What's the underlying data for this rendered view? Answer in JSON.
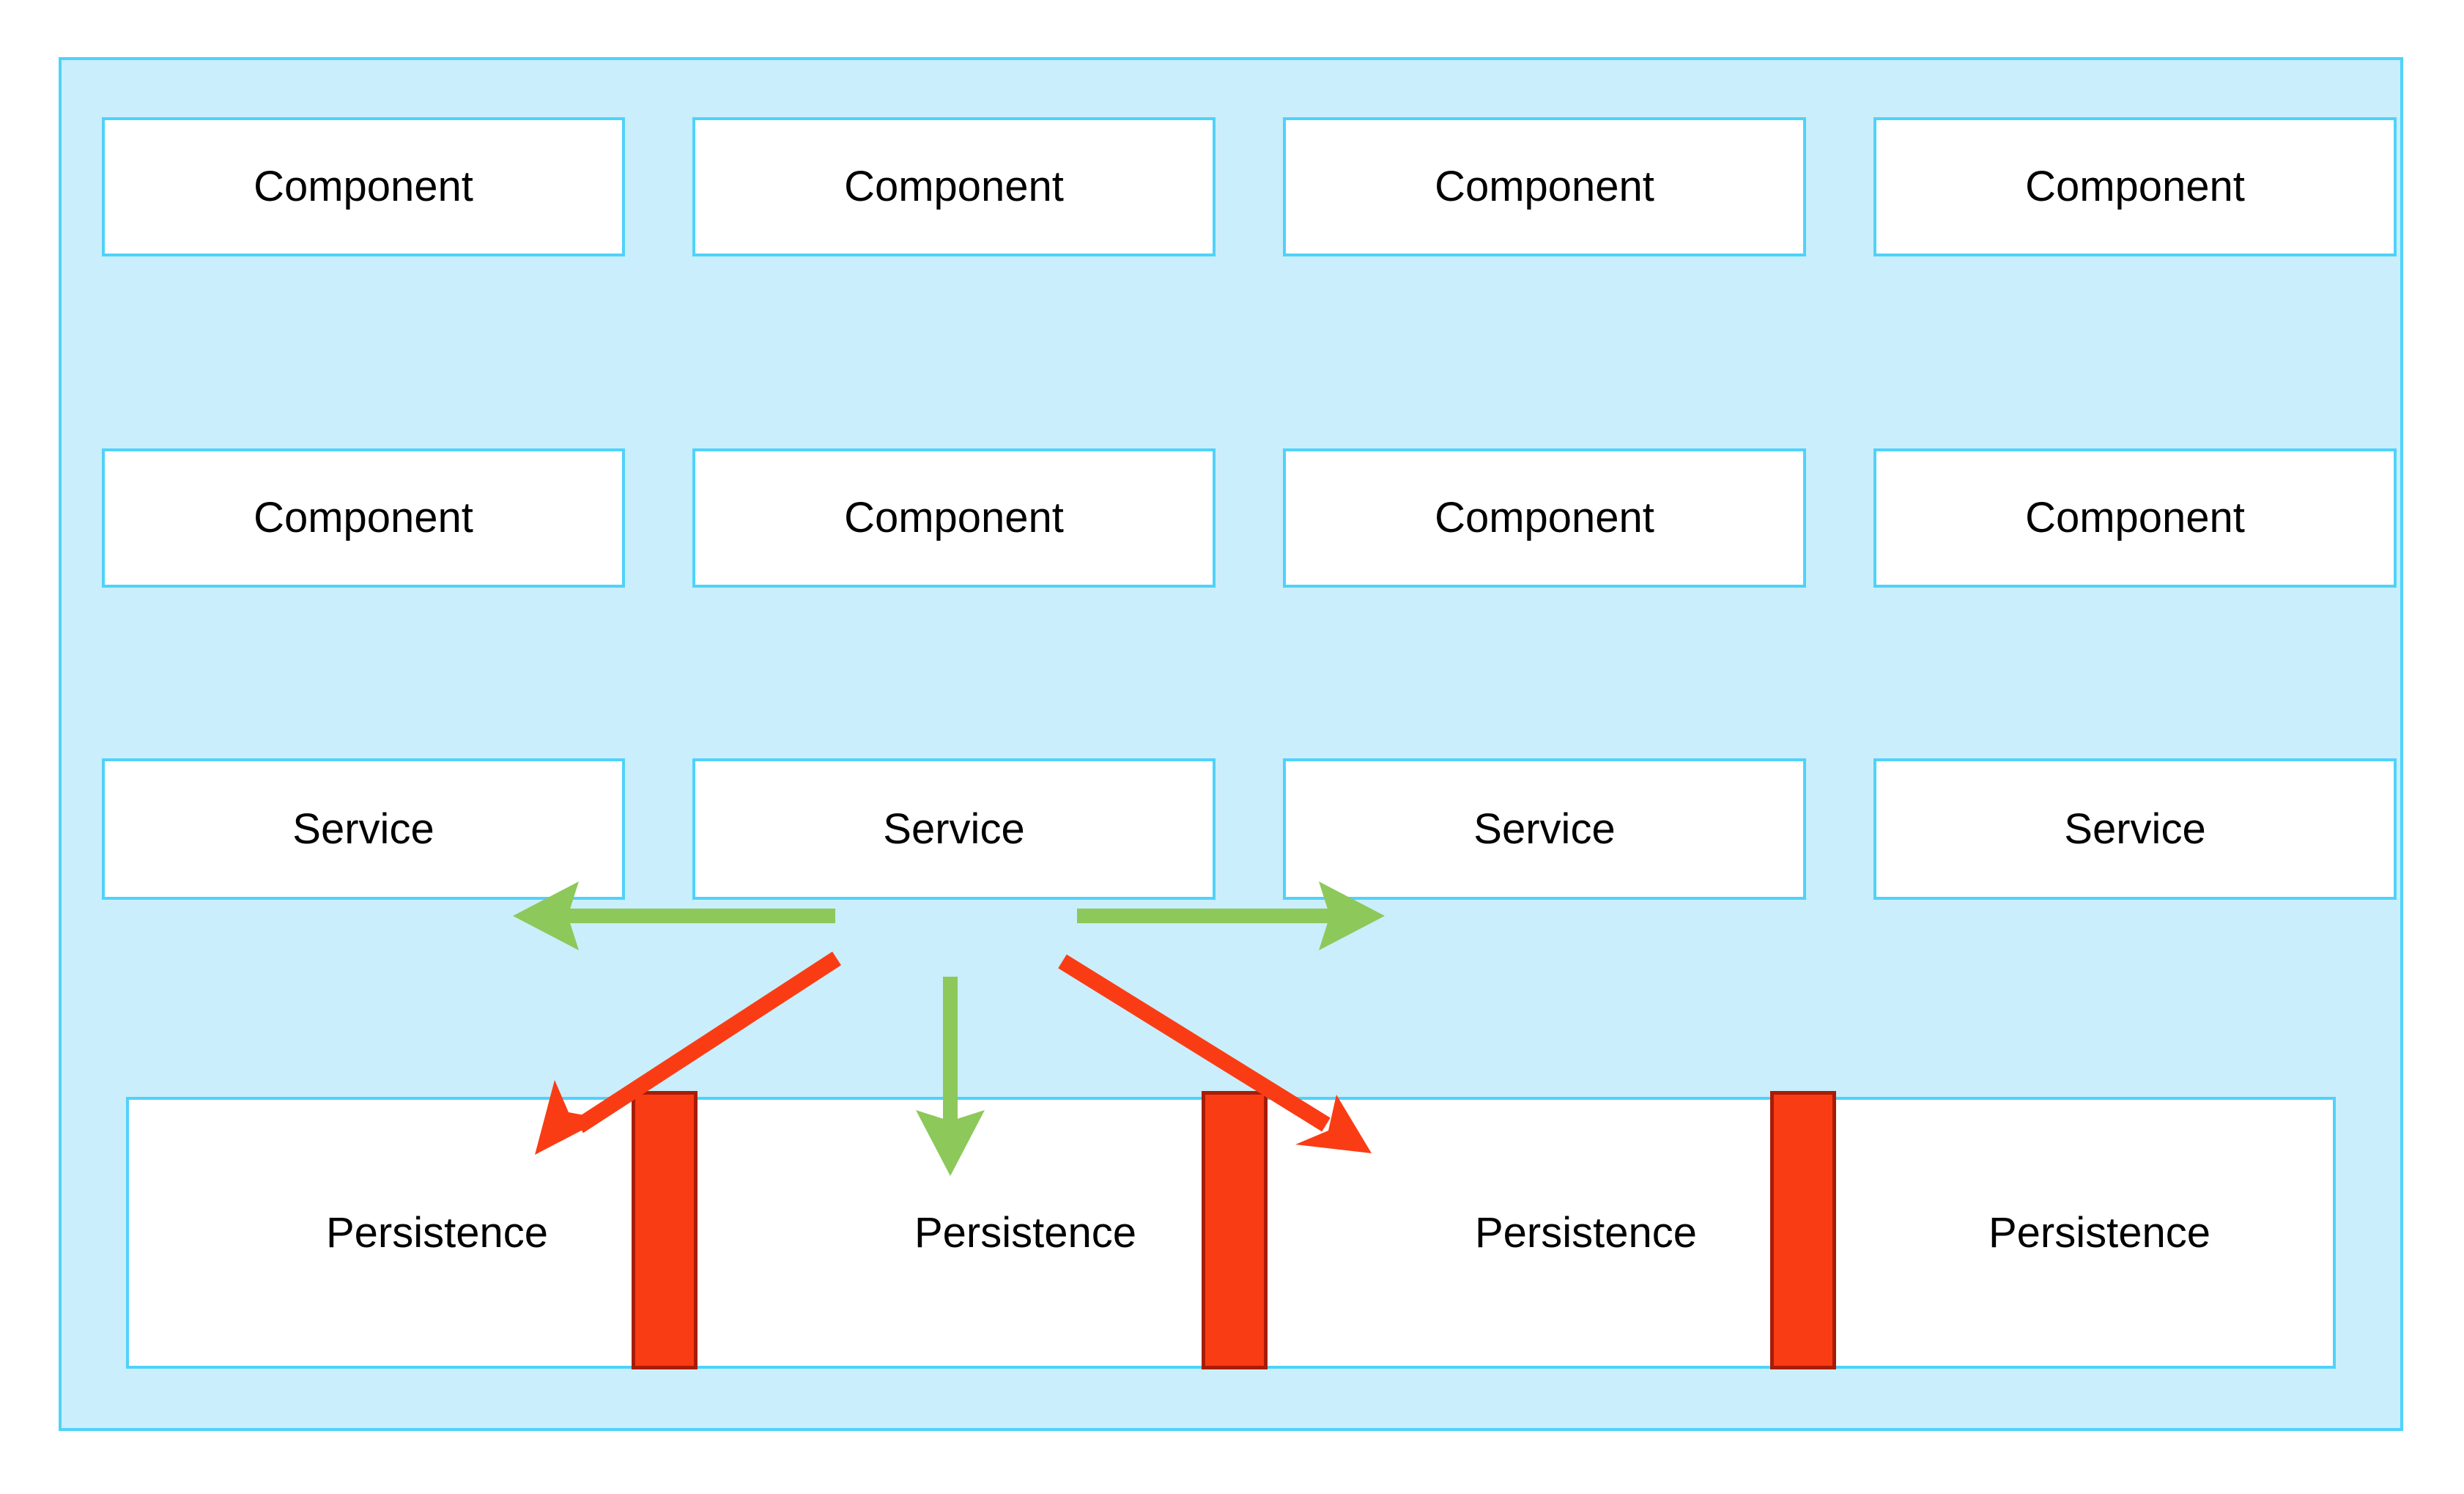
{
  "diagram": {
    "title": "Layered architecture diagram",
    "colors": {
      "container_fill": "#CAEEFB",
      "container_border": "#4FD2FA",
      "cell_fill": "#FFFFFF",
      "cell_border": "#4FD2FA",
      "green_arrow": "#8DC85A",
      "red_arrow": "#FA3C14",
      "red_bar_fill": "#FA3C14",
      "red_bar_border": "#A81C07",
      "text": "#000000"
    },
    "rows": [
      {
        "name": "component-row-1",
        "cells": [
          {
            "label": "Component"
          },
          {
            "label": "Component"
          },
          {
            "label": "Component"
          },
          {
            "label": "Component"
          }
        ]
      },
      {
        "name": "component-row-2",
        "cells": [
          {
            "label": "Component"
          },
          {
            "label": "Component"
          },
          {
            "label": "Component"
          },
          {
            "label": "Component"
          }
        ]
      },
      {
        "name": "service-row",
        "cells": [
          {
            "label": "Service"
          },
          {
            "label": "Service"
          },
          {
            "label": "Service"
          },
          {
            "label": "Service"
          }
        ]
      },
      {
        "name": "persistence-row",
        "cells": [
          {
            "label": "Persistence"
          },
          {
            "label": "Persistence"
          },
          {
            "label": "Persistence"
          },
          {
            "label": "Persistence"
          }
        ]
      }
    ],
    "connectors": [
      {
        "name": "service-to-service-left",
        "kind": "arrow",
        "color": "#8DC85A",
        "direction": "left"
      },
      {
        "name": "service-to-service-right",
        "kind": "arrow",
        "color": "#8DC85A",
        "direction": "right"
      },
      {
        "name": "service-to-persistence-down",
        "kind": "arrow",
        "color": "#8DC85A",
        "direction": "down"
      },
      {
        "name": "service-to-persistence-down-left",
        "kind": "arrow",
        "color": "#FA3C14",
        "direction": "down-left"
      },
      {
        "name": "service-to-persistence-down-right",
        "kind": "arrow",
        "color": "#FA3C14",
        "direction": "down-right"
      }
    ],
    "barriers": [
      {
        "name": "persistence-barrier-1"
      },
      {
        "name": "persistence-barrier-2"
      },
      {
        "name": "persistence-barrier-3"
      }
    ]
  }
}
